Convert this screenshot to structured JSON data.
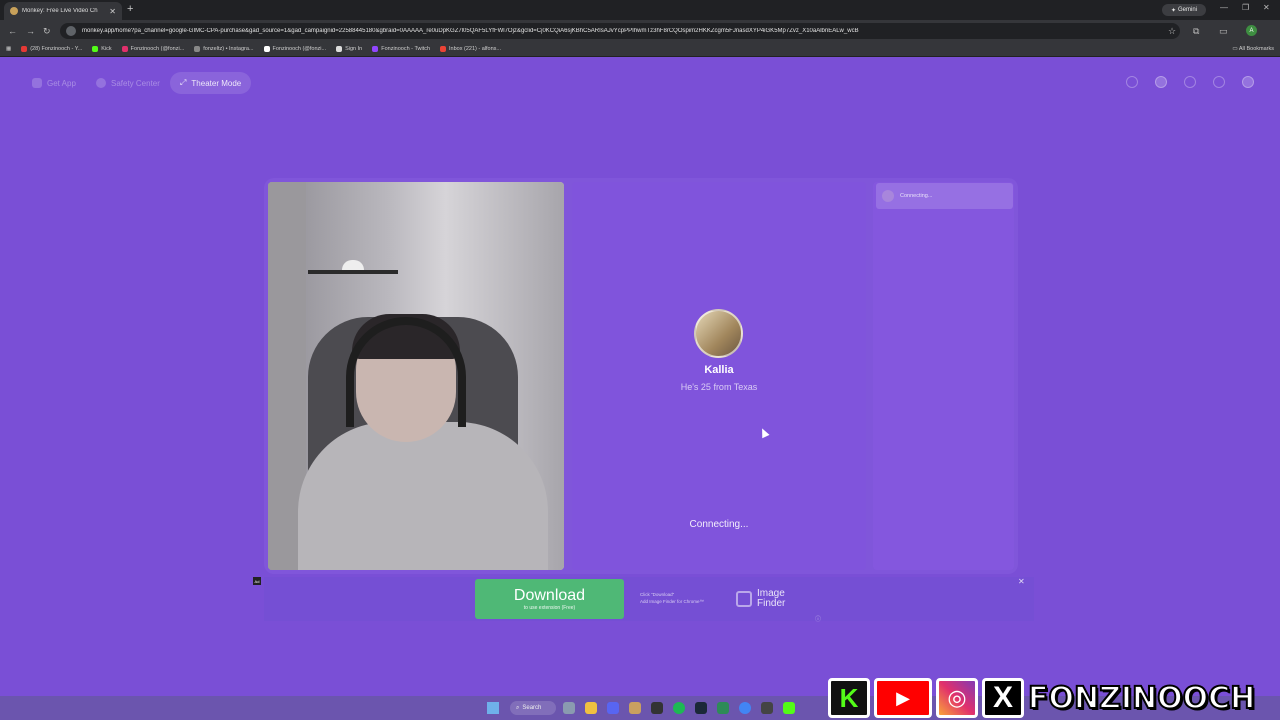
{
  "browser": {
    "tab_title": "Monkey: Free Live Video Ch",
    "new_tab": "+",
    "gemini": "Gemini",
    "url": "monkey.app/home?pa_channel=google-GIMC-CPA-purchase&gad_source=1&gad_campaignid=22588445180&gbraid=0AAAAA_re0uDpKGZ7l05QAF5LYfFWl7Ojz&gclid=Cj0KCQiA6sjKBhC5ARIsAJvYcpPPIhwmTz3hF8rCQOspim2HKKZcgm5FJnasdXYP4iGK5Mp7Zvz_X10aAlbnEALw_wcB",
    "bookmarks": [
      {
        "label": "(28) Fonzinooch - Y...",
        "color": "#e53935"
      },
      {
        "label": "Kick",
        "color": "#53fc18"
      },
      {
        "label": "Fonzinooch (@fonzi...",
        "color": "#e1306c"
      },
      {
        "label": "fonzeltz) • Instagra...",
        "color": "#888888"
      },
      {
        "label": "Fonzinooch (@fonzi...",
        "color": "#ffffff"
      },
      {
        "label": "Sign In",
        "color": "#ffffff"
      },
      {
        "label": "Fonzinooch - Twitch",
        "color": "#9146ff"
      },
      {
        "label": "Inbox (221) - alfons...",
        "color": "#ea4335"
      }
    ],
    "all_bookmarks": "All Bookmarks"
  },
  "app": {
    "nav": {
      "get_app": "Get App",
      "safety_center": "Safety Center",
      "theater_mode": "Theater Mode"
    },
    "partner": {
      "name": "Kallia",
      "info": "He's 25 from Texas",
      "status": "Connecting..."
    },
    "chat": {
      "status": "Connecting..."
    }
  },
  "ad": {
    "label": "Ad",
    "download_title": "Download",
    "download_sub": "to use extension (Free)",
    "step1": "Click \"Download\"",
    "step2": "Add Image Finder for Chrome™",
    "finder_line1": "Image",
    "finder_line2": "Finder",
    "close": "✕",
    "info": "ⓘ"
  },
  "taskbar": {
    "search": "Search"
  },
  "overlay": {
    "name": "FONZINOOCH",
    "kick_letter": "K",
    "x_letter": "X"
  }
}
